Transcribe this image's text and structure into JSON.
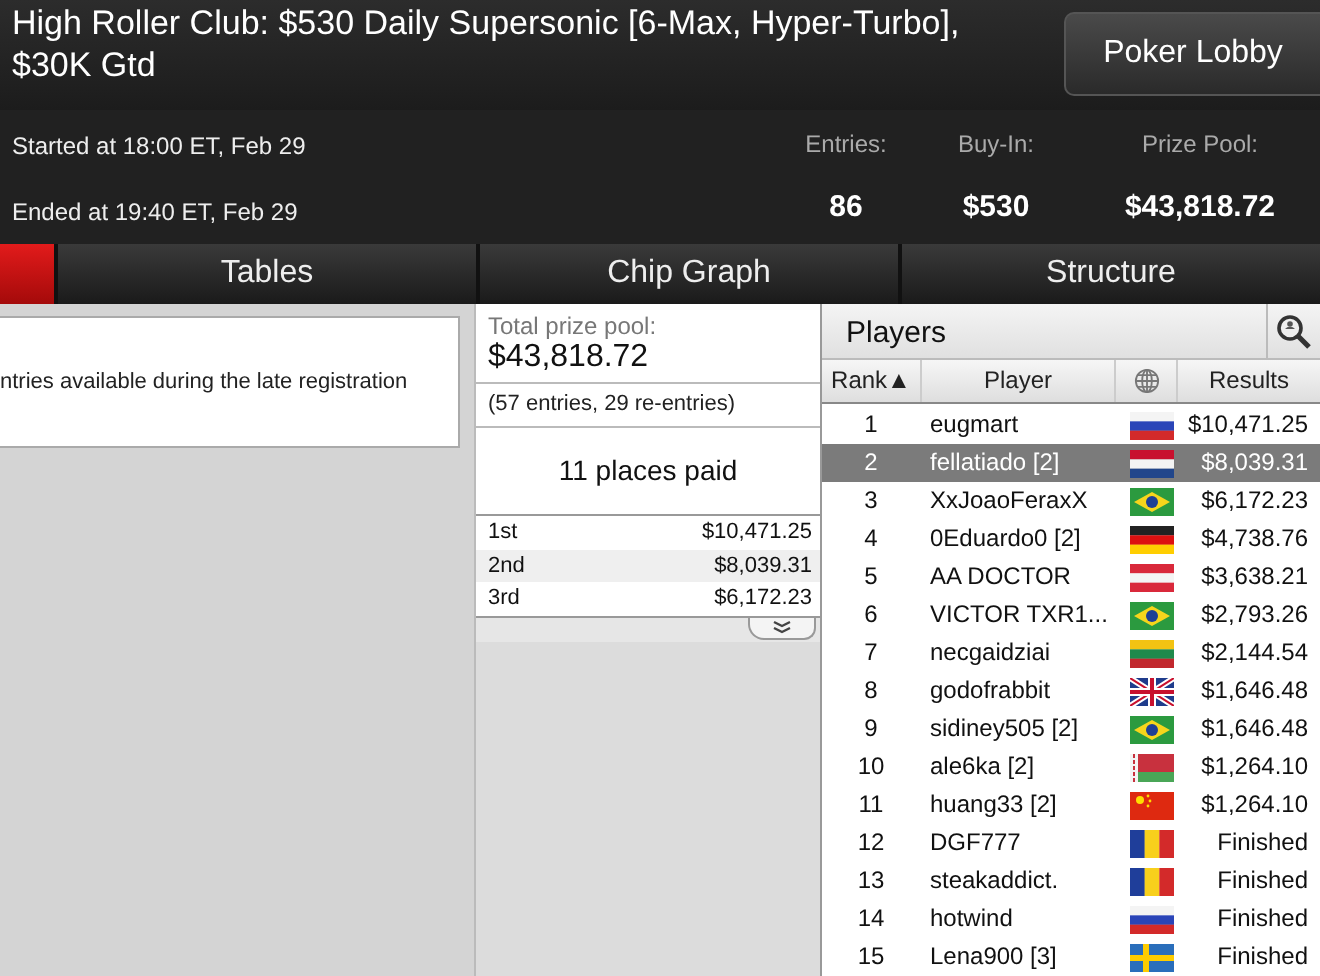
{
  "window": {
    "title": "High Roller Club: $530 Daily Supersonic [6-Max, Hyper-Turbo], $30K Gtd"
  },
  "lobby_button": "Poker Lobby",
  "times": [
    "Started at 18:00 ET, Feb 29",
    "Ended at 19:40 ET, Feb 29"
  ],
  "stats": [
    {
      "label": "Entries:",
      "value": "86"
    },
    {
      "label": "Buy-In:",
      "value": "$530"
    },
    {
      "label": "Prize Pool:",
      "value": "$43,818.72"
    }
  ],
  "tabs": [
    {
      "selected": true
    },
    {
      "label": "Tables",
      "selected": false
    },
    {
      "label": "Chip Graph",
      "selected": false
    },
    {
      "label": "Structure",
      "selected": false
    }
  ],
  "info_text": "ntries available during the late registration",
  "prize": {
    "title": "Total prize pool:",
    "amount": "$43,818.72",
    "entries": "(57 entries, 29 re-entries)",
    "places": "11 places paid",
    "payouts": [
      {
        "place": "1st",
        "amount": "$10,471.25"
      },
      {
        "place": "2nd",
        "amount": "$8,039.31"
      },
      {
        "place": "3rd",
        "amount": "$6,172.23"
      }
    ]
  },
  "players": {
    "title": "Players",
    "columns": [
      "Rank▲",
      "Player",
      "Results"
    ],
    "rows": [
      {
        "rank": "1",
        "name": "eugmart",
        "kind": "russia",
        "result": "$10,471.25",
        "selected": false
      },
      {
        "rank": "2",
        "name": "fellatiado [2]",
        "kind": "netherlands",
        "result": "$8,039.31",
        "selected": true
      },
      {
        "rank": "3",
        "name": "XxJoaoFeraxX",
        "kind": "brazil",
        "result": "$6,172.23",
        "selected": false
      },
      {
        "rank": "4",
        "name": "0Eduardo0 [2]",
        "kind": "germany",
        "result": "$4,738.76",
        "selected": false
      },
      {
        "rank": "5",
        "name": "AA DOCTOR",
        "kind": "austria",
        "result": "$3,638.21",
        "selected": false
      },
      {
        "rank": "6",
        "name": "VICTOR TXR1...",
        "kind": "brazil",
        "result": "$2,793.26",
        "selected": false
      },
      {
        "rank": "7",
        "name": "necgaidziai",
        "kind": "lithuania",
        "result": "$2,144.54",
        "selected": false
      },
      {
        "rank": "8",
        "name": "godofrabbit",
        "kind": "uk",
        "result": "$1,646.48",
        "selected": false
      },
      {
        "rank": "9",
        "name": "sidiney505 [2]",
        "kind": "brazil",
        "result": "$1,646.48",
        "selected": false
      },
      {
        "rank": "10",
        "name": "ale6ka [2]",
        "kind": "belarus",
        "result": "$1,264.10",
        "selected": false
      },
      {
        "rank": "11",
        "name": "huang33 [2]",
        "kind": "china",
        "result": "$1,264.10",
        "selected": false
      },
      {
        "rank": "12",
        "name": "DGF777",
        "kind": "romania",
        "result": "Finished",
        "selected": false
      },
      {
        "rank": "13",
        "name": "steakaddict.",
        "kind": "romania",
        "result": "Finished",
        "selected": false
      },
      {
        "rank": "14",
        "name": "hotwind",
        "kind": "russia",
        "result": "Finished",
        "selected": false
      },
      {
        "rank": "15",
        "name": "Lena900 [3]",
        "kind": "sweden",
        "result": "Finished",
        "selected": false
      }
    ]
  }
}
